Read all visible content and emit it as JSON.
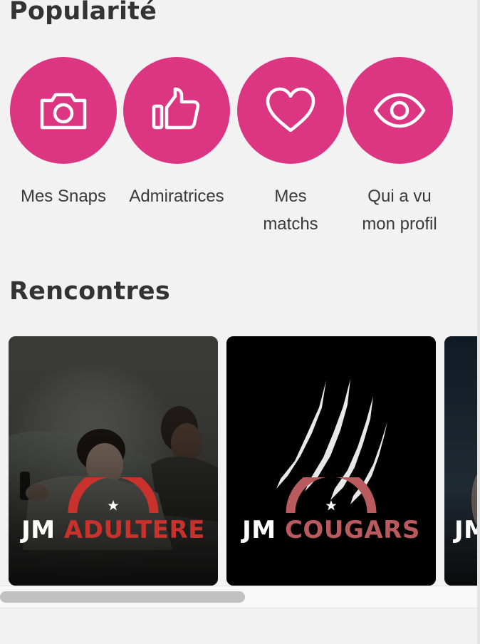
{
  "popularite": {
    "title": "Popularité",
    "items": [
      {
        "label_line1": "Mes Snaps",
        "label_line2": "",
        "icon": "camera-icon"
      },
      {
        "label_line1": "Admiratrices",
        "label_line2": "",
        "icon": "thumbs-up-icon"
      },
      {
        "label_line1": "Mes",
        "label_line2": "matchs",
        "icon": "heart-icon"
      },
      {
        "label_line1": "Qui a vu",
        "label_line2": "mon profil",
        "icon": "eye-icon"
      }
    ],
    "accent_color": "#dc3582"
  },
  "rencontres": {
    "title": "Rencontres",
    "cards": [
      {
        "prefix": "JM",
        "name": "ADULTERE",
        "name_color": "#c9322c"
      },
      {
        "prefix": "JM",
        "name": "COUGARS",
        "name_color": "#b85a5e"
      },
      {
        "prefix": "JM",
        "name": ""
      }
    ]
  }
}
